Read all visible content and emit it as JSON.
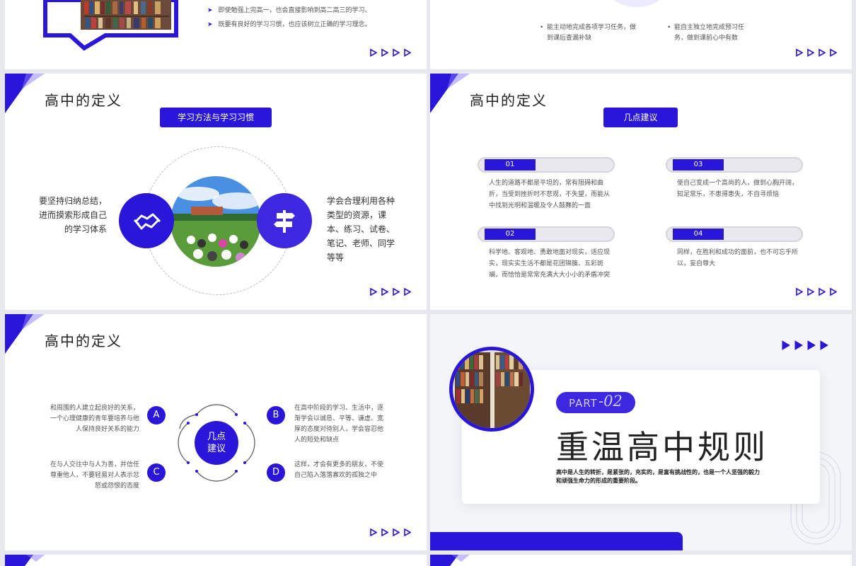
{
  "colors": {
    "accent": "#2a16d8",
    "accent_light": "#8a7dff"
  },
  "slide1": {
    "bullets": [
      "即使勉强上完高一，也会直接影响到高二高三的学习。",
      "既要有良好的学习习惯，也应该树立正确的学习理念。"
    ]
  },
  "slide2": {
    "items": [
      "能主动地完成各项学习任务，做到课后查漏补缺",
      "能自主独立地完成预习任务，做到课前心中有数"
    ]
  },
  "slide3": {
    "title": "高中的定义",
    "header": "学习方法与学习习惯",
    "left_text": "要坚持归纳总结，进而摸索形成自己的学习体系",
    "right_text": "学会合理利用各种类型的资源，课本、练习、试卷、笔记、老师、同学等等",
    "left_icon": "handshake-icon",
    "right_icon": "signpost-icon"
  },
  "slide4": {
    "title": "高中的定义",
    "header": "几点建议",
    "items": [
      {
        "num": "01",
        "text": "人生的道路不都是平坦的，常有阻碍和曲折，当受到挫折时不悲观，不失望，而能从中找到光明和温暖及令人鼓舞的一面"
      },
      {
        "num": "03",
        "text": "使自己变成一个高尚的人，做到心胸开阔，知足常乐，不患得患失，不自寻烦恼"
      },
      {
        "num": "02",
        "text": "科学地、客观地、勇敢地面对现实，适应现实，现实实生活不都是花团锦簇、五彩斑斓，而恰恰是常常充满大大小小的矛盾冲突"
      },
      {
        "num": "04",
        "text": "同样，在胜利和成功的面前，也不可忘乎所以，妄自尊大"
      }
    ]
  },
  "slide5": {
    "title": "高中的定义",
    "center": "几点建议",
    "items": [
      {
        "letter": "A",
        "text": "和周围的人建立起良好的关系，一个心理健康的青年要培养与他人保持良好关系的能力"
      },
      {
        "letter": "B",
        "text": "在高中阶段的学习、生活中，逐渐学会以诚恳、平等、谦虚、宽厚的态度对待别人，学会容忍他人的短处和缺点"
      },
      {
        "letter": "C",
        "text": "在与人交往中与人为善，并信任尊重他人，不要轻易对人表示忿怒或怨恨的态度"
      },
      {
        "letter": "D",
        "text": "这样，才会有更多的朋友，不使自己陷入落落寡欢的孤独之中"
      }
    ]
  },
  "slide6": {
    "part_label": "PART",
    "part_num": "-02",
    "title": "重温高中规则",
    "desc": "高中是人生的转折，是紧张的，充实的，是富有挑战性的，也是一个人坚强的毅力和顽强生命力的形成的重要阶段。"
  }
}
